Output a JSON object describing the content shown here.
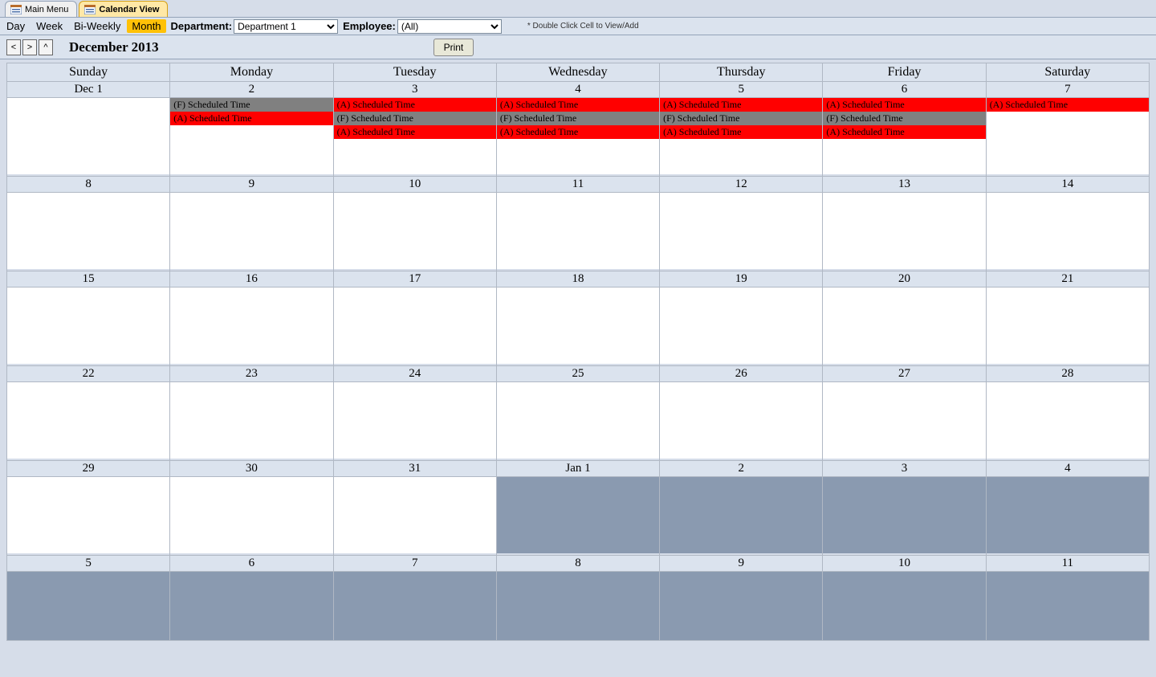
{
  "tabs": {
    "main_menu": "Main Menu",
    "calendar_view": "Calendar View"
  },
  "toolbar": {
    "views": {
      "day": "Day",
      "week": "Week",
      "biweekly": "Bi-Weekly",
      "month": "Month"
    },
    "department_label": "Department:",
    "department_value": "Department 1",
    "employee_label": "Employee:",
    "employee_value": "(All)",
    "hint": "* Double Click Cell to View/Add"
  },
  "header": {
    "prev": "<",
    "next": ">",
    "up": "^",
    "month": "December 2013",
    "print": "Print"
  },
  "dayheaders": [
    "Sunday",
    "Monday",
    "Tuesday",
    "Wednesday",
    "Thursday",
    "Friday",
    "Saturday"
  ],
  "weeks": [
    {
      "days": [
        {
          "label": "Dec 1",
          "other": false,
          "events": []
        },
        {
          "label": "2",
          "other": false,
          "events": [
            {
              "text": "(F) Scheduled Time",
              "color": "gray"
            },
            {
              "text": "(A) Scheduled Time",
              "color": "red"
            }
          ]
        },
        {
          "label": "3",
          "other": false,
          "events": [
            {
              "text": "(A) Scheduled Time",
              "color": "red"
            },
            {
              "text": "(F) Scheduled Time",
              "color": "gray"
            },
            {
              "text": "(A) Scheduled Time",
              "color": "red"
            }
          ]
        },
        {
          "label": "4",
          "other": false,
          "events": [
            {
              "text": "(A) Scheduled Time",
              "color": "red"
            },
            {
              "text": "(F) Scheduled Time",
              "color": "gray"
            },
            {
              "text": "(A) Scheduled Time",
              "color": "red"
            }
          ]
        },
        {
          "label": "5",
          "other": false,
          "events": [
            {
              "text": "(A) Scheduled Time",
              "color": "red"
            },
            {
              "text": "(F) Scheduled Time",
              "color": "gray"
            },
            {
              "text": "(A) Scheduled Time",
              "color": "red"
            }
          ]
        },
        {
          "label": "6",
          "other": false,
          "events": [
            {
              "text": "(A) Scheduled Time",
              "color": "red"
            },
            {
              "text": "(F) Scheduled Time",
              "color": "gray"
            },
            {
              "text": "(A) Scheduled Time",
              "color": "red"
            }
          ]
        },
        {
          "label": "7",
          "other": false,
          "events": [
            {
              "text": "(A) Scheduled Time",
              "color": "red"
            }
          ]
        }
      ]
    },
    {
      "days": [
        {
          "label": "8",
          "other": false,
          "events": []
        },
        {
          "label": "9",
          "other": false,
          "events": []
        },
        {
          "label": "10",
          "other": false,
          "events": []
        },
        {
          "label": "11",
          "other": false,
          "events": []
        },
        {
          "label": "12",
          "other": false,
          "events": []
        },
        {
          "label": "13",
          "other": false,
          "events": []
        },
        {
          "label": "14",
          "other": false,
          "events": []
        }
      ]
    },
    {
      "days": [
        {
          "label": "15",
          "other": false,
          "events": []
        },
        {
          "label": "16",
          "other": false,
          "events": []
        },
        {
          "label": "17",
          "other": false,
          "events": []
        },
        {
          "label": "18",
          "other": false,
          "events": []
        },
        {
          "label": "19",
          "other": false,
          "events": []
        },
        {
          "label": "20",
          "other": false,
          "events": []
        },
        {
          "label": "21",
          "other": false,
          "events": []
        }
      ]
    },
    {
      "days": [
        {
          "label": "22",
          "other": false,
          "events": []
        },
        {
          "label": "23",
          "other": false,
          "events": []
        },
        {
          "label": "24",
          "other": false,
          "events": []
        },
        {
          "label": "25",
          "other": false,
          "events": []
        },
        {
          "label": "26",
          "other": false,
          "events": []
        },
        {
          "label": "27",
          "other": false,
          "events": []
        },
        {
          "label": "28",
          "other": false,
          "events": []
        }
      ]
    },
    {
      "days": [
        {
          "label": "29",
          "other": false,
          "events": []
        },
        {
          "label": "30",
          "other": false,
          "events": []
        },
        {
          "label": "31",
          "other": false,
          "events": []
        },
        {
          "label": "Jan 1",
          "other": true,
          "events": []
        },
        {
          "label": "2",
          "other": true,
          "events": []
        },
        {
          "label": "3",
          "other": true,
          "events": []
        },
        {
          "label": "4",
          "other": true,
          "events": []
        }
      ]
    },
    {
      "short": true,
      "days": [
        {
          "label": "5",
          "other": true,
          "events": []
        },
        {
          "label": "6",
          "other": true,
          "events": []
        },
        {
          "label": "7",
          "other": true,
          "events": []
        },
        {
          "label": "8",
          "other": true,
          "events": []
        },
        {
          "label": "9",
          "other": true,
          "events": []
        },
        {
          "label": "10",
          "other": true,
          "events": []
        },
        {
          "label": "11",
          "other": true,
          "events": []
        }
      ]
    }
  ]
}
